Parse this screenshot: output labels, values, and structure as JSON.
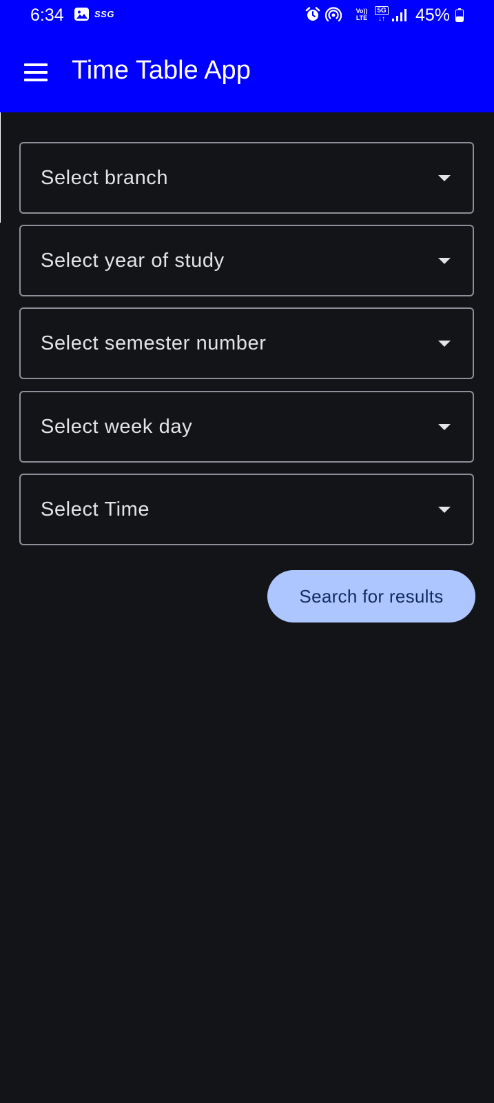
{
  "status_bar": {
    "time": "6:34",
    "carrier_tag": "SSG",
    "volte_top": "Vo))",
    "volte_bottom": "LTE",
    "network": "5G",
    "network_arrows": "↓↑",
    "battery_percent": "45%",
    "battery_level": 0.45,
    "icons": [
      "gallery-icon",
      "alarm-icon",
      "hotspot-icon",
      "volte-icon",
      "5g-icon",
      "signal-icon",
      "battery-icon"
    ]
  },
  "app_bar": {
    "title": "Time Table App",
    "menu_icon": "hamburger-menu-icon",
    "background_color": "#0000fe"
  },
  "form": {
    "dropdowns": [
      {
        "id": "branch",
        "placeholder": "Select branch"
      },
      {
        "id": "year",
        "placeholder": "Select year of study"
      },
      {
        "id": "semester",
        "placeholder": "Select semester number"
      },
      {
        "id": "weekday",
        "placeholder": "Select week day"
      },
      {
        "id": "time",
        "placeholder": "Select Time"
      }
    ],
    "search_button_label": "Search for results",
    "search_button_color": "#adc6ff"
  },
  "theme": {
    "background": "#131417",
    "outline": "#8e9099",
    "text": "#e3e3e8"
  }
}
